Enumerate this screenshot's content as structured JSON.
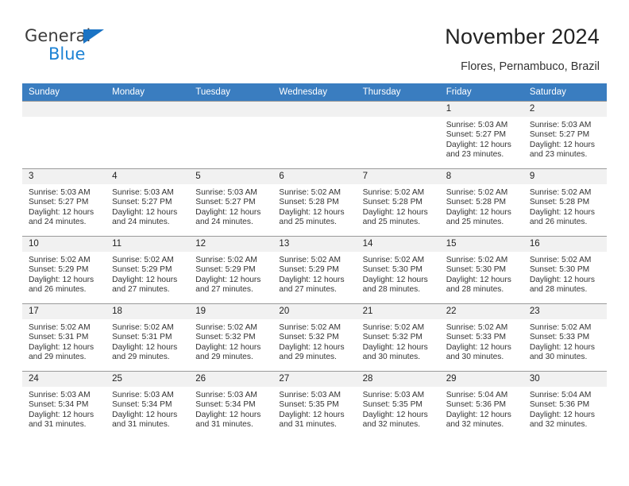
{
  "brand": {
    "name_dark": "General",
    "name_blue": "Blue",
    "accent_color": "#1c82d4",
    "header_color": "#3a7dc0"
  },
  "header": {
    "title": "November 2024",
    "subtitle": "Flores, Pernambuco, Brazil"
  },
  "calendar": {
    "weekday_headers": [
      "Sunday",
      "Monday",
      "Tuesday",
      "Wednesday",
      "Thursday",
      "Friday",
      "Saturday"
    ],
    "weeks": [
      [
        {
          "day": "",
          "sunrise": "",
          "sunset": "",
          "daylight": "",
          "daylight2": ""
        },
        {
          "day": "",
          "sunrise": "",
          "sunset": "",
          "daylight": "",
          "daylight2": ""
        },
        {
          "day": "",
          "sunrise": "",
          "sunset": "",
          "daylight": "",
          "daylight2": ""
        },
        {
          "day": "",
          "sunrise": "",
          "sunset": "",
          "daylight": "",
          "daylight2": ""
        },
        {
          "day": "",
          "sunrise": "",
          "sunset": "",
          "daylight": "",
          "daylight2": ""
        },
        {
          "day": "1",
          "sunrise": "Sunrise: 5:03 AM",
          "sunset": "Sunset: 5:27 PM",
          "daylight": "Daylight: 12 hours",
          "daylight2": "and 23 minutes."
        },
        {
          "day": "2",
          "sunrise": "Sunrise: 5:03 AM",
          "sunset": "Sunset: 5:27 PM",
          "daylight": "Daylight: 12 hours",
          "daylight2": "and 23 minutes."
        }
      ],
      [
        {
          "day": "3",
          "sunrise": "Sunrise: 5:03 AM",
          "sunset": "Sunset: 5:27 PM",
          "daylight": "Daylight: 12 hours",
          "daylight2": "and 24 minutes."
        },
        {
          "day": "4",
          "sunrise": "Sunrise: 5:03 AM",
          "sunset": "Sunset: 5:27 PM",
          "daylight": "Daylight: 12 hours",
          "daylight2": "and 24 minutes."
        },
        {
          "day": "5",
          "sunrise": "Sunrise: 5:03 AM",
          "sunset": "Sunset: 5:27 PM",
          "daylight": "Daylight: 12 hours",
          "daylight2": "and 24 minutes."
        },
        {
          "day": "6",
          "sunrise": "Sunrise: 5:02 AM",
          "sunset": "Sunset: 5:28 PM",
          "daylight": "Daylight: 12 hours",
          "daylight2": "and 25 minutes."
        },
        {
          "day": "7",
          "sunrise": "Sunrise: 5:02 AM",
          "sunset": "Sunset: 5:28 PM",
          "daylight": "Daylight: 12 hours",
          "daylight2": "and 25 minutes."
        },
        {
          "day": "8",
          "sunrise": "Sunrise: 5:02 AM",
          "sunset": "Sunset: 5:28 PM",
          "daylight": "Daylight: 12 hours",
          "daylight2": "and 25 minutes."
        },
        {
          "day": "9",
          "sunrise": "Sunrise: 5:02 AM",
          "sunset": "Sunset: 5:28 PM",
          "daylight": "Daylight: 12 hours",
          "daylight2": "and 26 minutes."
        }
      ],
      [
        {
          "day": "10",
          "sunrise": "Sunrise: 5:02 AM",
          "sunset": "Sunset: 5:29 PM",
          "daylight": "Daylight: 12 hours",
          "daylight2": "and 26 minutes."
        },
        {
          "day": "11",
          "sunrise": "Sunrise: 5:02 AM",
          "sunset": "Sunset: 5:29 PM",
          "daylight": "Daylight: 12 hours",
          "daylight2": "and 27 minutes."
        },
        {
          "day": "12",
          "sunrise": "Sunrise: 5:02 AM",
          "sunset": "Sunset: 5:29 PM",
          "daylight": "Daylight: 12 hours",
          "daylight2": "and 27 minutes."
        },
        {
          "day": "13",
          "sunrise": "Sunrise: 5:02 AM",
          "sunset": "Sunset: 5:29 PM",
          "daylight": "Daylight: 12 hours",
          "daylight2": "and 27 minutes."
        },
        {
          "day": "14",
          "sunrise": "Sunrise: 5:02 AM",
          "sunset": "Sunset: 5:30 PM",
          "daylight": "Daylight: 12 hours",
          "daylight2": "and 28 minutes."
        },
        {
          "day": "15",
          "sunrise": "Sunrise: 5:02 AM",
          "sunset": "Sunset: 5:30 PM",
          "daylight": "Daylight: 12 hours",
          "daylight2": "and 28 minutes."
        },
        {
          "day": "16",
          "sunrise": "Sunrise: 5:02 AM",
          "sunset": "Sunset: 5:30 PM",
          "daylight": "Daylight: 12 hours",
          "daylight2": "and 28 minutes."
        }
      ],
      [
        {
          "day": "17",
          "sunrise": "Sunrise: 5:02 AM",
          "sunset": "Sunset: 5:31 PM",
          "daylight": "Daylight: 12 hours",
          "daylight2": "and 29 minutes."
        },
        {
          "day": "18",
          "sunrise": "Sunrise: 5:02 AM",
          "sunset": "Sunset: 5:31 PM",
          "daylight": "Daylight: 12 hours",
          "daylight2": "and 29 minutes."
        },
        {
          "day": "19",
          "sunrise": "Sunrise: 5:02 AM",
          "sunset": "Sunset: 5:32 PM",
          "daylight": "Daylight: 12 hours",
          "daylight2": "and 29 minutes."
        },
        {
          "day": "20",
          "sunrise": "Sunrise: 5:02 AM",
          "sunset": "Sunset: 5:32 PM",
          "daylight": "Daylight: 12 hours",
          "daylight2": "and 29 minutes."
        },
        {
          "day": "21",
          "sunrise": "Sunrise: 5:02 AM",
          "sunset": "Sunset: 5:32 PM",
          "daylight": "Daylight: 12 hours",
          "daylight2": "and 30 minutes."
        },
        {
          "day": "22",
          "sunrise": "Sunrise: 5:02 AM",
          "sunset": "Sunset: 5:33 PM",
          "daylight": "Daylight: 12 hours",
          "daylight2": "and 30 minutes."
        },
        {
          "day": "23",
          "sunrise": "Sunrise: 5:02 AM",
          "sunset": "Sunset: 5:33 PM",
          "daylight": "Daylight: 12 hours",
          "daylight2": "and 30 minutes."
        }
      ],
      [
        {
          "day": "24",
          "sunrise": "Sunrise: 5:03 AM",
          "sunset": "Sunset: 5:34 PM",
          "daylight": "Daylight: 12 hours",
          "daylight2": "and 31 minutes."
        },
        {
          "day": "25",
          "sunrise": "Sunrise: 5:03 AM",
          "sunset": "Sunset: 5:34 PM",
          "daylight": "Daylight: 12 hours",
          "daylight2": "and 31 minutes."
        },
        {
          "day": "26",
          "sunrise": "Sunrise: 5:03 AM",
          "sunset": "Sunset: 5:34 PM",
          "daylight": "Daylight: 12 hours",
          "daylight2": "and 31 minutes."
        },
        {
          "day": "27",
          "sunrise": "Sunrise: 5:03 AM",
          "sunset": "Sunset: 5:35 PM",
          "daylight": "Daylight: 12 hours",
          "daylight2": "and 31 minutes."
        },
        {
          "day": "28",
          "sunrise": "Sunrise: 5:03 AM",
          "sunset": "Sunset: 5:35 PM",
          "daylight": "Daylight: 12 hours",
          "daylight2": "and 32 minutes."
        },
        {
          "day": "29",
          "sunrise": "Sunrise: 5:04 AM",
          "sunset": "Sunset: 5:36 PM",
          "daylight": "Daylight: 12 hours",
          "daylight2": "and 32 minutes."
        },
        {
          "day": "30",
          "sunrise": "Sunrise: 5:04 AM",
          "sunset": "Sunset: 5:36 PM",
          "daylight": "Daylight: 12 hours",
          "daylight2": "and 32 minutes."
        }
      ]
    ]
  }
}
